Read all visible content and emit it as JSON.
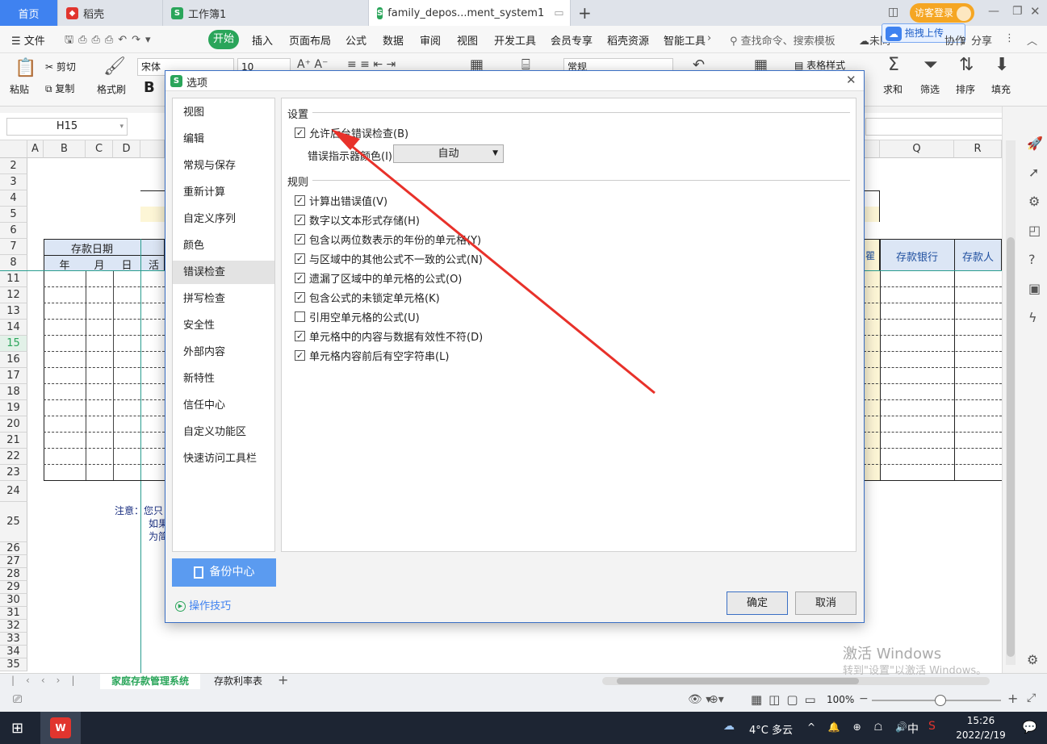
{
  "tabs": {
    "home": "首页",
    "daoke": "稻壳",
    "workbook1": "工作簿1",
    "active": "family_depos...ment_system1",
    "visitor": "访客登录",
    "upload": "拖拽上传"
  },
  "menu": {
    "file": "文件",
    "start": "开始",
    "insert": "插入",
    "layout": "页面布局",
    "formula": "公式",
    "data": "数据",
    "review": "审阅",
    "view": "视图",
    "dev": "开发工具",
    "member": "会员专享",
    "resource": "稻壳资源",
    "smart": "智能工具",
    "search": "查找命令、搜索模板",
    "unsync": "未同",
    "collab": "协作",
    "share": "分享"
  },
  "ribbon": {
    "paste": "粘贴",
    "cut": "剪切",
    "copy": "复制",
    "format_painter": "格式刷",
    "font": "宋体",
    "size": "10",
    "bold": "B",
    "number_format": "常规",
    "table_style": "表格样式",
    "sum": "求和",
    "filter": "筛选",
    "sort": "排序",
    "fill": "填充"
  },
  "namebox": "H15",
  "sheet": {
    "col_headers": [
      "A",
      "B",
      "C",
      "D",
      "Q",
      "R"
    ],
    "rows": [
      "2",
      "3",
      "4",
      "5",
      "6",
      "7",
      "8",
      "11",
      "12",
      "13",
      "14",
      "15",
      "16",
      "17",
      "18",
      "19",
      "20",
      "21",
      "22",
      "23",
      "24",
      "25",
      "26",
      "27",
      "28",
      "29",
      "30",
      "31",
      "32",
      "33",
      "34",
      "35"
    ],
    "deposit_date": "存款日期",
    "year": "年",
    "month": "月",
    "day": "日",
    "live": "活",
    "bank": "存款银行",
    "depositor": "存款人",
    "partial_col": "瞿",
    "note_label": "注意：",
    "note_l1": "您只",
    "note_l2": "如果",
    "note_l3": "为简"
  },
  "sheet_tabs": [
    "家庭存款管理系统",
    "存款利率表"
  ],
  "status": {
    "zoom": "100%",
    "watermark": "激活 Windows",
    "watermark2": "转到\"设置\"以激活 Windows。"
  },
  "taskbar": {
    "weather": "4°C 多云",
    "ime": "中",
    "time": "15:26",
    "date": "2022/2/19"
  },
  "dialog": {
    "title": "选项",
    "nav": [
      "视图",
      "编辑",
      "常规与保存",
      "重新计算",
      "自定义序列",
      "颜色",
      "错误检查",
      "拼写检查",
      "安全性",
      "外部内容",
      "新特性",
      "信任中心",
      "自定义功能区",
      "快速访问工具栏"
    ],
    "backup": "备份中心",
    "tips": "操作技巧",
    "section_settings": "设置",
    "allow_bg": "允许后台错误检查(B)",
    "indicator_label": "错误指示器颜色(I):",
    "indicator_value": "自动",
    "section_rules": "规则",
    "rules": [
      {
        "label": "计算出错误值(V)",
        "checked": true
      },
      {
        "label": "数字以文本形式存储(H)",
        "checked": true
      },
      {
        "label": "包含以两位数表示的年份的单元格(Y)",
        "checked": true
      },
      {
        "label": "与区域中的其他公式不一致的公式(N)",
        "checked": true
      },
      {
        "label": "遗漏了区域中的单元格的公式(O)",
        "checked": true
      },
      {
        "label": "包含公式的未锁定单元格(K)",
        "checked": true
      },
      {
        "label": "引用空单元格的公式(U)",
        "checked": false
      },
      {
        "label": "单元格中的内容与数据有效性不符(D)",
        "checked": true
      },
      {
        "label": "单元格内容前后有空字符串(L)",
        "checked": true
      }
    ],
    "ok": "确定",
    "cancel": "取消"
  },
  "colors": {
    "accent": "#3f82f0",
    "arrow": "#e8312a",
    "header_fill": "#dce6f5",
    "yellow_fill": "#fdf6d6"
  }
}
